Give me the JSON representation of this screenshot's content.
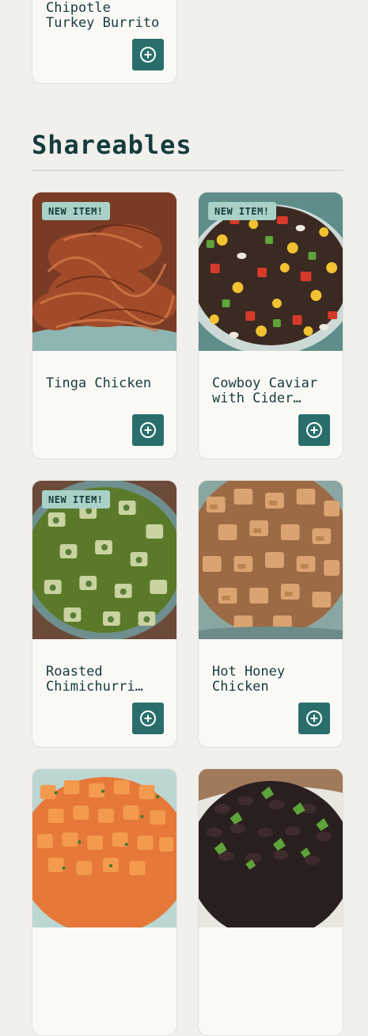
{
  "prev_card": {
    "name": "Chipotle Turkey Burrito"
  },
  "section": {
    "title": "Shareables"
  },
  "items": [
    {
      "name": "Tinga Chicken",
      "badge": "NEW ITEM!"
    },
    {
      "name": "Cowboy Caviar with Cider Vinaigrette",
      "badge": "NEW ITEM!"
    },
    {
      "name": "Roasted Chimichurri Chicken",
      "badge": "NEW ITEM!"
    },
    {
      "name": "Hot Honey Chicken",
      "badge": ""
    },
    {
      "name": "",
      "badge": ""
    },
    {
      "name": "",
      "badge": ""
    }
  ],
  "icons": {
    "add": "plus-circle-icon"
  },
  "colors": {
    "background": "#f1f0ec",
    "accent": "#2a6e6c",
    "badge": "#a9d1c8",
    "text": "#153c3c"
  }
}
